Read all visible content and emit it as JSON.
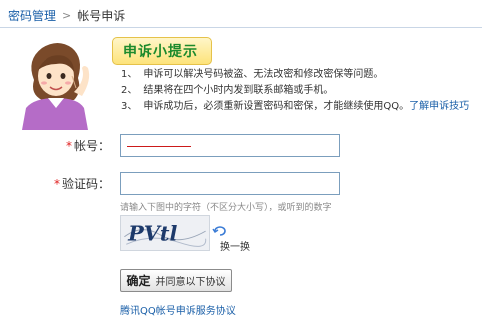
{
  "breadcrumb": {
    "parent": "密码管理",
    "separator": ">",
    "current": "帐号申诉"
  },
  "tips": {
    "title": "申诉小提示",
    "items": [
      {
        "num": "1、",
        "text": "申诉可以解决号码被盗、无法改密和修改密保等问题。"
      },
      {
        "num": "2、",
        "text": "结果将在四个小时内发到联系邮箱或手机。"
      },
      {
        "num": "3、",
        "text": "申诉成功后，必须重新设置密码和密保，才能继续使用QQ。",
        "link": "了解申诉技巧"
      }
    ]
  },
  "form": {
    "account": {
      "required_mark": "*",
      "label": "帐号：",
      "value": ""
    },
    "captcha": {
      "required_mark": "*",
      "label": "验证码：",
      "value": "",
      "hint": "请输入下图中的字符（不区分大小写），或听到的数字",
      "image_text": "PVtl",
      "refresh_label": "换一换"
    },
    "submit": {
      "main": "确定",
      "sub": "并同意以下协议"
    },
    "agreement_link": "腾讯QQ帐号申诉服务协议"
  },
  "colors": {
    "link": "#1a5fa8",
    "tips_title": "#1c8a2c",
    "required": "#e02020"
  }
}
